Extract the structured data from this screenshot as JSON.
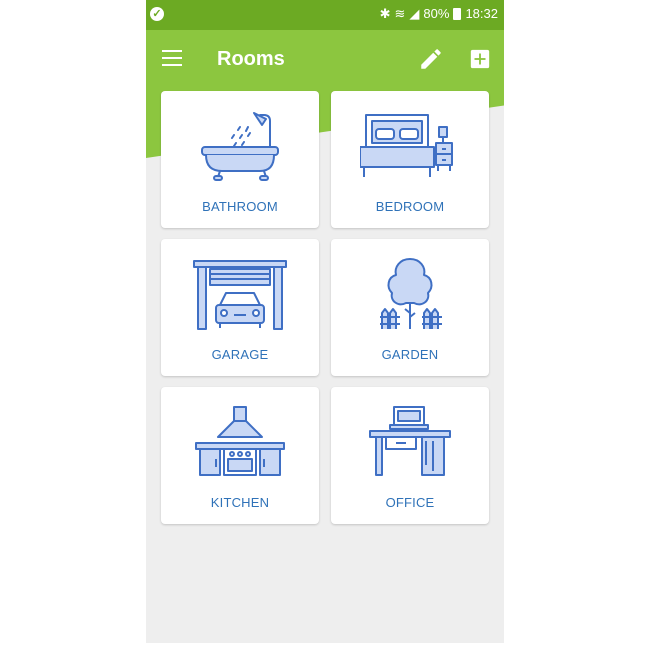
{
  "status_bar": {
    "battery_text": "80%",
    "time": "18:32",
    "icons": [
      "check-circle-icon",
      "bluetooth-icon",
      "wifi-icon",
      "signal-icon",
      "battery-icon"
    ]
  },
  "app_bar": {
    "title": "Rooms",
    "menu_icon": "hamburger-menu-icon",
    "edit_icon": "pencil-icon",
    "add_icon": "add-box-icon"
  },
  "rooms": [
    {
      "label": "BATHROOM",
      "icon": "bathtub-icon"
    },
    {
      "label": "BEDROOM",
      "icon": "bed-icon"
    },
    {
      "label": "GARAGE",
      "icon": "garage-icon"
    },
    {
      "label": "GARDEN",
      "icon": "tree-icon"
    },
    {
      "label": "KITCHEN",
      "icon": "kitchen-icon"
    },
    {
      "label": "OFFICE",
      "icon": "desk-icon"
    }
  ],
  "colors": {
    "status_bar": "#6caa23",
    "app_bar": "#8cc63f",
    "background": "#eeeeee",
    "card": "#ffffff",
    "label": "#2f72b8",
    "icon_stroke": "#3f6fc4",
    "icon_fill": "#c9d8f5"
  }
}
